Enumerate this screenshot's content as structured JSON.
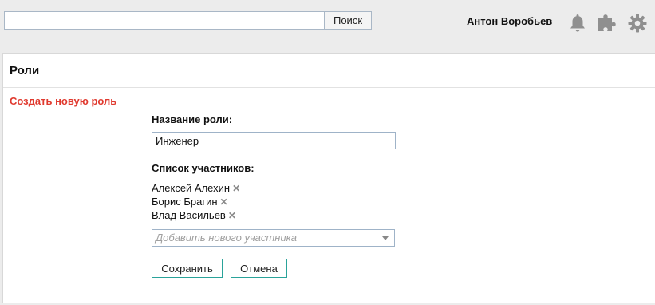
{
  "search": {
    "value": "",
    "placeholder": "",
    "button_label": "Поиск"
  },
  "header": {
    "user_name": "Антон Воробьев",
    "icons": [
      "bell-icon",
      "puzzle-icon",
      "gear-icon"
    ]
  },
  "panel": {
    "title": "Роли",
    "create_link": "Создать новую роль"
  },
  "form": {
    "name_label": "Название роли:",
    "name_value": "Инженер",
    "members_label": "Список участников:",
    "members": [
      {
        "name": "Алексей Алехин"
      },
      {
        "name": "Борис Брагин"
      },
      {
        "name": "Влад Васильев"
      }
    ],
    "add_member_placeholder": "Добавить нового участника",
    "save_label": "Сохранить",
    "cancel_label": "Отмена"
  },
  "colors": {
    "accent_link": "#e03a2f",
    "button_border": "#2aa39a",
    "icon_gray": "#8f8f8f"
  }
}
